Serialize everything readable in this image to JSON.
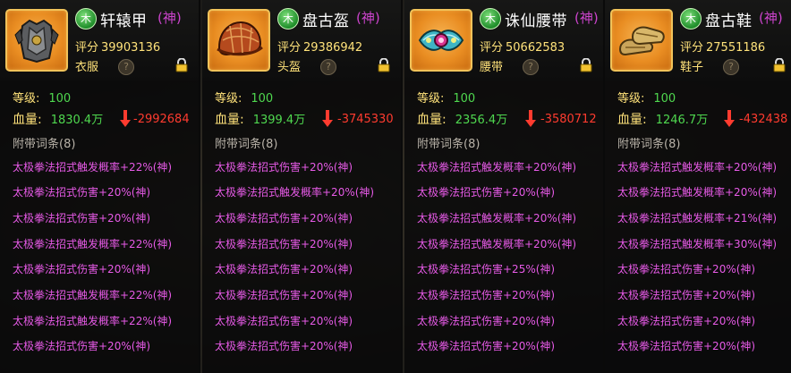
{
  "cards": [
    {
      "name": "轩辕甲",
      "rank": "(神)",
      "score_label": "评分",
      "score": "39903136",
      "slot": "衣服",
      "level_label": "等级:",
      "level": "100",
      "hp_label": "血量:",
      "hp": "1830.4万",
      "hp_diff": "-2992684",
      "affix_header": "附带词条(8)",
      "affixes": [
        "太极拳法招式触发概率+22%(神)",
        "太极拳法招式伤害+20%(神)",
        "太极拳法招式伤害+20%(神)",
        "太极拳法招式触发概率+22%(神)",
        "太极拳法招式伤害+20%(神)",
        "太极拳法招式触发概率+22%(神)",
        "太极拳法招式触发概率+22%(神)",
        "太极拳法招式伤害+20%(神)"
      ],
      "icon": "armor-icon"
    },
    {
      "name": "盘古盔",
      "rank": "(神)",
      "score_label": "评分",
      "score": "29386942",
      "slot": "头盔",
      "level_label": "等级:",
      "level": "100",
      "hp_label": "血量:",
      "hp": "1399.4万",
      "hp_diff": "-3745330",
      "affix_header": "附带词条(8)",
      "affixes": [
        "太极拳法招式伤害+20%(神)",
        "太极拳法招式触发概率+20%(神)",
        "太极拳法招式伤害+20%(神)",
        "太极拳法招式伤害+20%(神)",
        "太极拳法招式伤害+20%(神)",
        "太极拳法招式伤害+20%(神)",
        "太极拳法招式伤害+20%(神)",
        "太极拳法招式伤害+20%(神)"
      ],
      "icon": "helmet-icon"
    },
    {
      "name": "诛仙腰带",
      "rank": "(神)",
      "score_label": "评分",
      "score": "50662583",
      "slot": "腰带",
      "level_label": "等级:",
      "level": "100",
      "hp_label": "血量:",
      "hp": "2356.4万",
      "hp_diff": "-3580712",
      "affix_header": "附带词条(8)",
      "affixes": [
        "太极拳法招式触发概率+20%(神)",
        "太极拳法招式伤害+20%(神)",
        "太极拳法招式触发概率+20%(神)",
        "太极拳法招式触发概率+20%(神)",
        "太极拳法招式伤害+25%(神)",
        "太极拳法招式伤害+20%(神)",
        "太极拳法招式伤害+20%(神)",
        "太极拳法招式伤害+20%(神)"
      ],
      "icon": "belt-icon"
    },
    {
      "name": "盘古鞋",
      "rank": "(神)",
      "score_label": "评分",
      "score": "27551186",
      "slot": "鞋子",
      "level_label": "等级:",
      "level": "100",
      "hp_label": "血量:",
      "hp": "1246.7万",
      "hp_diff": "-432438",
      "affix_header": "附带词条(8)",
      "affixes": [
        "太极拳法招式触发概率+20%(神)",
        "太极拳法招式触发概率+20%(神)",
        "太极拳法招式触发概率+21%(神)",
        "太极拳法招式触发概率+30%(神)",
        "太极拳法招式伤害+20%(神)",
        "太极拳法招式伤害+20%(神)",
        "太极拳法招式伤害+20%(神)",
        "太极拳法招式伤害+20%(神)"
      ],
      "icon": "boots-icon"
    }
  ],
  "element_badge": "木",
  "help_glyph": "?",
  "colors": {
    "rank": "#cc44cc",
    "affix": "#e65ae6",
    "level_value": "#4fd84f",
    "hp_diff": "#ff3b2f",
    "label": "#ffe27a"
  }
}
